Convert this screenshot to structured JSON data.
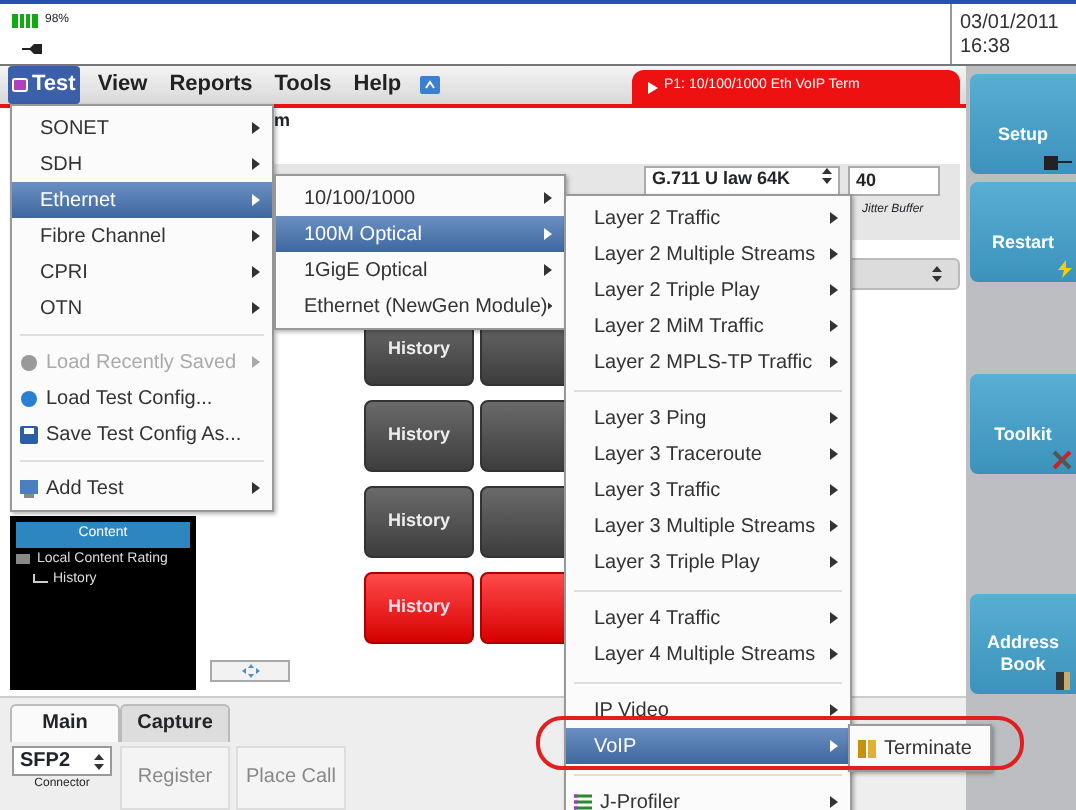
{
  "status_bar": {
    "battery": "98%",
    "date": "03/01/2011",
    "time": "16:38"
  },
  "menu_bar": [
    {
      "label": "Test",
      "selected": true
    },
    {
      "label": "View",
      "selected": false
    },
    {
      "label": "Reports",
      "selected": false
    },
    {
      "label": "Tools",
      "selected": false
    },
    {
      "label": "Help",
      "selected": false
    }
  ],
  "test_tab": "P1: 10/100/1000 Eth VoIP Term",
  "content": {
    "title": "m",
    "codec": "G.711 U law 64K",
    "jitter_value": "40",
    "jitter_label": "Jitter Buffer"
  },
  "history_buttons": [
    {
      "label": "History",
      "alarm": false
    },
    {
      "label": "History",
      "alarm": false
    },
    {
      "label": "History",
      "alarm": false
    },
    {
      "label": "History",
      "alarm": true
    }
  ],
  "tree": [
    {
      "label": "Content",
      "selected": true
    },
    {
      "label": "Local Content Rating",
      "selected": false,
      "children": [
        {
          "label": "History",
          "selected": false
        }
      ]
    }
  ],
  "test_menu": [
    {
      "kind": "item",
      "label": "SONET",
      "selected": false,
      "submenu": true
    },
    {
      "kind": "item",
      "label": "SDH",
      "selected": false,
      "submenu": true
    },
    {
      "kind": "item",
      "label": "Ethernet",
      "selected": true,
      "submenu": true
    },
    {
      "kind": "item",
      "label": "Fibre Channel",
      "selected": false,
      "submenu": true
    },
    {
      "kind": "item",
      "label": "CPRI",
      "selected": false,
      "submenu": true
    },
    {
      "kind": "item",
      "label": "OTN",
      "selected": false,
      "submenu": true
    },
    {
      "kind": "separator"
    },
    {
      "kind": "file-item",
      "label": "Load Recently Saved",
      "selected": false,
      "disabled": true,
      "submenu": true
    },
    {
      "kind": "file-item",
      "label": "Load Test Config...",
      "selected": false,
      "submenu": false
    },
    {
      "kind": "file-item",
      "label": "Save Test Config As...",
      "selected": false,
      "submenu": false
    },
    {
      "kind": "separator"
    },
    {
      "kind": "file-item",
      "label": "Add Test",
      "selected": false,
      "submenu": true
    }
  ],
  "ethernet_menu": [
    {
      "kind": "item",
      "label": "10/100/1000",
      "selected": false,
      "submenu": true
    },
    {
      "kind": "item",
      "label": "100M Optical",
      "selected": true,
      "submenu": true
    },
    {
      "kind": "item",
      "label": "1GigE Optical",
      "selected": false,
      "submenu": true
    },
    {
      "kind": "item",
      "label": "Ethernet (NewGen Module)",
      "selected": false,
      "submenu": true
    }
  ],
  "optical_menu": [
    {
      "kind": "item",
      "label": "Layer 2 Traffic",
      "selected": false,
      "submenu": true
    },
    {
      "kind": "item",
      "label": "Layer 2 Multiple Streams",
      "selected": false,
      "submenu": true
    },
    {
      "kind": "item",
      "label": "Layer 2 Triple Play",
      "selected": false,
      "submenu": true
    },
    {
      "kind": "item",
      "label": "Layer 2 MiM Traffic",
      "selected": false,
      "submenu": true
    },
    {
      "kind": "item",
      "label": "Layer 2 MPLS-TP Traffic",
      "selected": false,
      "submenu": true
    },
    {
      "kind": "separator"
    },
    {
      "kind": "item",
      "label": "Layer 3 Ping",
      "selected": false,
      "submenu": true
    },
    {
      "kind": "item",
      "label": "Layer 3 Traceroute",
      "selected": false,
      "submenu": true
    },
    {
      "kind": "item",
      "label": "Layer 3 Traffic",
      "selected": false,
      "submenu": true
    },
    {
      "kind": "item",
      "label": "Layer 3 Multiple Streams",
      "selected": false,
      "submenu": true
    },
    {
      "kind": "item",
      "label": "Layer 3 Triple Play",
      "selected": false,
      "submenu": true
    },
    {
      "kind": "separator"
    },
    {
      "kind": "item",
      "label": "Layer 4 Traffic",
      "selected": false,
      "submenu": true
    },
    {
      "kind": "item",
      "label": "Layer 4 Multiple Streams",
      "selected": false,
      "submenu": true
    },
    {
      "kind": "separator"
    },
    {
      "kind": "item",
      "label": "IP Video",
      "selected": false,
      "submenu": true
    },
    {
      "kind": "item",
      "label": "VoIP",
      "selected": true,
      "submenu": true
    },
    {
      "kind": "separator"
    },
    {
      "kind": "file-item",
      "label": "J-Profiler",
      "selected": false,
      "submenu": true
    }
  ],
  "voip_menu": [
    {
      "kind": "file-item",
      "label": "Terminate",
      "selected": false,
      "submenu": false
    }
  ],
  "side_buttons": [
    {
      "label": "Setup"
    },
    {
      "label": "Restart"
    },
    {
      "label": "Toolkit"
    },
    {
      "label": "Address Book"
    }
  ],
  "bottom_tabs": [
    {
      "label": "Main",
      "selected": true
    },
    {
      "label": "Capture",
      "selected": false
    }
  ],
  "connector": {
    "value": "SFP2",
    "label": "Connector"
  },
  "actions": [
    "Register",
    "Place Call"
  ]
}
